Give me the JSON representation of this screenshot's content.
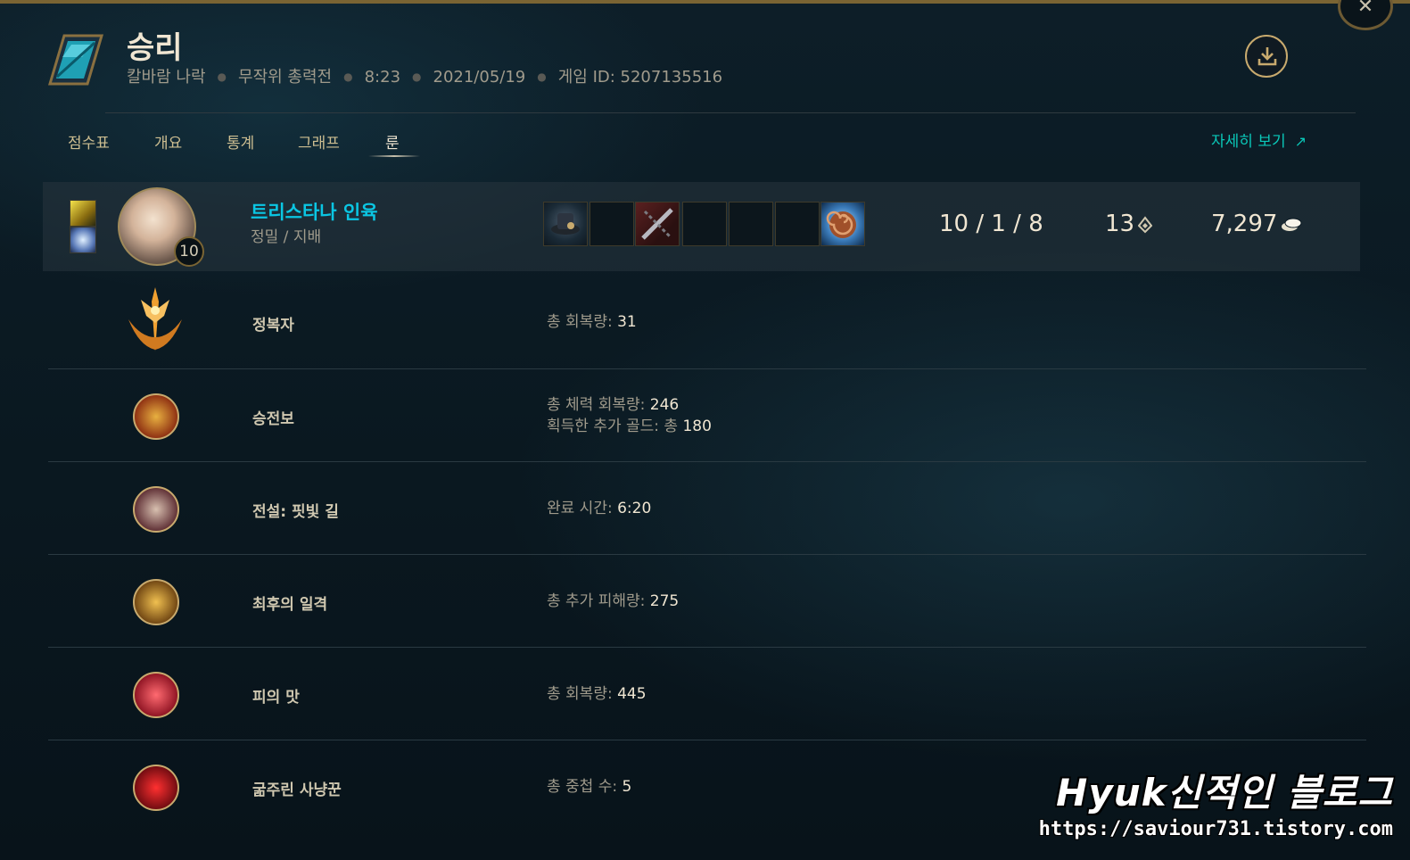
{
  "header": {
    "result": "승리",
    "meta": [
      "칼바람 나락",
      "무작위 총력전",
      "8:23",
      "2021/05/19",
      "게임 ID: 5207135516"
    ]
  },
  "tabs": [
    {
      "label": "점수표"
    },
    {
      "label": "개요"
    },
    {
      "label": "통계"
    },
    {
      "label": "그래프"
    },
    {
      "label": "룬",
      "active": true
    }
  ],
  "details_link": "자세히 보기",
  "player": {
    "champion_name": "트리스타나 인육",
    "rune_paths": "정밀 / 지배",
    "level": "10",
    "kda": "10 / 1 / 8",
    "cs": "13",
    "gold": "7,297",
    "items": [
      "item-hat",
      "empty",
      "item-chain-weapon",
      "empty",
      "empty",
      "empty",
      "item-cinnamon-roll"
    ]
  },
  "runes": [
    {
      "name": "정복자",
      "stats": [
        {
          "label": "총 회복량: ",
          "value": "31"
        }
      ],
      "icon": "conqueror-icon",
      "colors": [
        "#f0a030",
        "#7a3a10"
      ]
    },
    {
      "name": "승전보",
      "stats": [
        {
          "label": "총 체력 회복량: ",
          "value": "246"
        },
        {
          "label": "획득한 추가 골드: 총 ",
          "value": "180"
        }
      ],
      "icon": "triumph-icon",
      "colors": [
        "#e8b040",
        "#8a2a10"
      ]
    },
    {
      "name": "전설: 핏빛 길",
      "stats": [
        {
          "label": "완료 시간: ",
          "value": "6:20"
        }
      ],
      "icon": "legend-bloodline-icon",
      "colors": [
        "#d8c0b0",
        "#5a2a30"
      ]
    },
    {
      "name": "최후의 일격",
      "stats": [
        {
          "label": "총 추가 피해량: ",
          "value": "275"
        }
      ],
      "icon": "coup-de-grace-icon",
      "colors": [
        "#f0c050",
        "#6a4010"
      ]
    },
    {
      "name": "피의 맛",
      "stats": [
        {
          "label": "총 회복량: ",
          "value": "445"
        }
      ],
      "icon": "taste-of-blood-icon",
      "colors": [
        "#ff6a70",
        "#8a1020"
      ]
    },
    {
      "name": "굶주린 사냥꾼",
      "stats": [
        {
          "label": "총 중첩 수: ",
          "value": "5"
        }
      ],
      "icon": "ravenous-hunter-icon",
      "colors": [
        "#ff3030",
        "#6a0a10"
      ]
    }
  ],
  "watermark": {
    "title": "Hyuk신적인 블로그",
    "url": "https://saviour731.tistory.com"
  }
}
